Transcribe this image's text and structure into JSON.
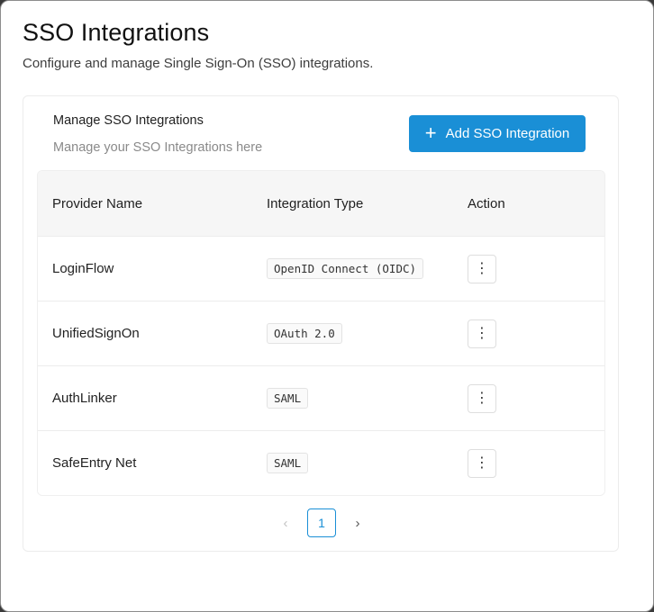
{
  "page": {
    "title": "SSO Integrations",
    "subtitle": "Configure and manage Single Sign-On (SSO) integrations."
  },
  "card": {
    "title": "Manage SSO Integrations",
    "subtitle": "Manage your SSO Integrations here",
    "add_button_icon": "+",
    "add_button_label": "Add SSO Integration"
  },
  "table": {
    "headers": [
      "Provider Name",
      "Integration Type",
      "Action"
    ],
    "rows": [
      {
        "provider": "LoginFlow",
        "type": "OpenID Connect (OIDC)"
      },
      {
        "provider": "UnifiedSignOn",
        "type": "OAuth 2.0"
      },
      {
        "provider": "AuthLinker",
        "type": "SAML"
      },
      {
        "provider": "SafeEntry Net",
        "type": "SAML"
      }
    ],
    "action_icon": "⋮"
  },
  "pagination": {
    "prev_icon": "‹",
    "current_page": "1",
    "next_icon": "›"
  },
  "colors": {
    "accent": "#1a8fd6",
    "header_bg": "#f6f6f6"
  }
}
